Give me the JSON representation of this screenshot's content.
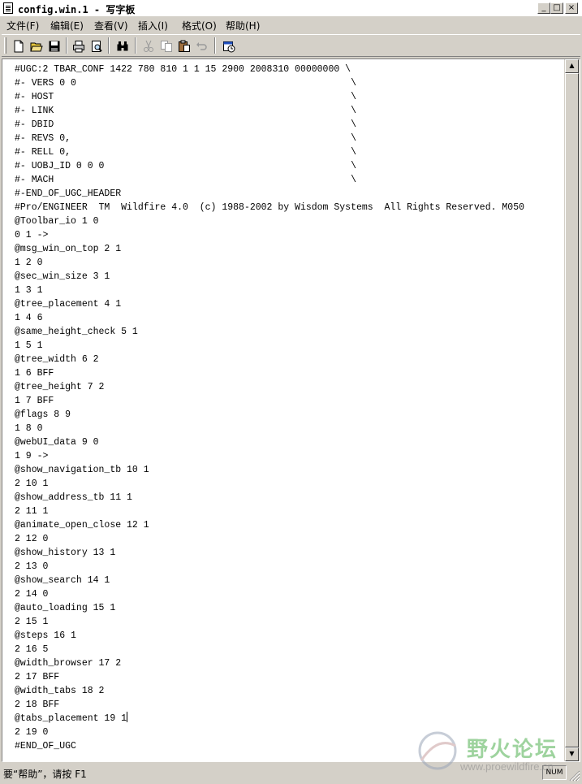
{
  "window": {
    "title": "config.win.1 - 写字板",
    "controls": {
      "minimize": "_",
      "maximize": "□",
      "close": "×"
    }
  },
  "menu": [
    {
      "label": "文件(F)"
    },
    {
      "label": "编辑(E)"
    },
    {
      "label": "查看(V)"
    },
    {
      "label": "插入(I)"
    },
    {
      "label": "格式(O)"
    },
    {
      "label": "帮助(H)"
    }
  ],
  "toolbar": {
    "buttons": [
      {
        "icon": "new-document-icon"
      },
      {
        "icon": "open-folder-icon"
      },
      {
        "icon": "save-disk-icon"
      },
      {
        "icon": "print-icon"
      },
      {
        "icon": "print-preview-icon"
      },
      {
        "icon": "find-binoculars-icon"
      },
      {
        "icon": "cut-scissors-icon"
      },
      {
        "icon": "copy-icon"
      },
      {
        "icon": "paste-clipboard-icon"
      },
      {
        "icon": "undo-icon"
      },
      {
        "icon": "insert-datetime-icon"
      }
    ]
  },
  "document": {
    "lines": [
      "#UGC:2 TBAR_CONF 1422 780 810 1 1 15 2900 2008310 00000000 \\",
      "#- VERS 0 0                                                 \\",
      "#- HOST                                                     \\",
      "#- LINK                                                     \\",
      "#- DBID                                                     \\",
      "#- REVS 0,                                                  \\",
      "#- RELL 0,                                                  \\",
      "#- UOBJ_ID 0 0 0                                            \\",
      "#- MACH                                                     \\",
      "#-END_OF_UGC_HEADER",
      "#Pro/ENGINEER  TM  Wildfire 4.0  (c) 1988-2002 by Wisdom Systems  All Rights Reserved. M050",
      "@Toolbar_io 1 0",
      "0 1 ->",
      "@msg_win_on_top 2 1",
      "1 2 0",
      "@sec_win_size 3 1",
      "1 3 1",
      "@tree_placement 4 1",
      "1 4 6",
      "@same_height_check 5 1",
      "1 5 1",
      "@tree_width 6 2",
      "1 6 BFF",
      "@tree_height 7 2",
      "1 7 BFF",
      "@flags 8 9",
      "1 8 0",
      "@webUI_data 9 0",
      "1 9 ->",
      "@show_navigation_tb 10 1",
      "2 10 1",
      "@show_address_tb 11 1",
      "2 11 1",
      "@animate_open_close 12 1",
      "2 12 0",
      "@show_history 13 1",
      "2 13 0",
      "@show_search 14 1",
      "2 14 0",
      "@auto_loading 15 1",
      "2 15 1",
      "@steps 16 1",
      "2 16 5",
      "@width_browser 17 2",
      "2 17 BFF",
      "@width_tabs 18 2",
      "2 18 BFF",
      "@tabs_placement 19 1",
      "2 19 0",
      "#END_OF_UGC"
    ],
    "caret_line": 47
  },
  "statusbar": {
    "text": "要“帮助”，请按 F1",
    "num_indicator": "NUM"
  },
  "watermark": {
    "title": "野火论坛",
    "url": "www.proewildfire.cn"
  }
}
